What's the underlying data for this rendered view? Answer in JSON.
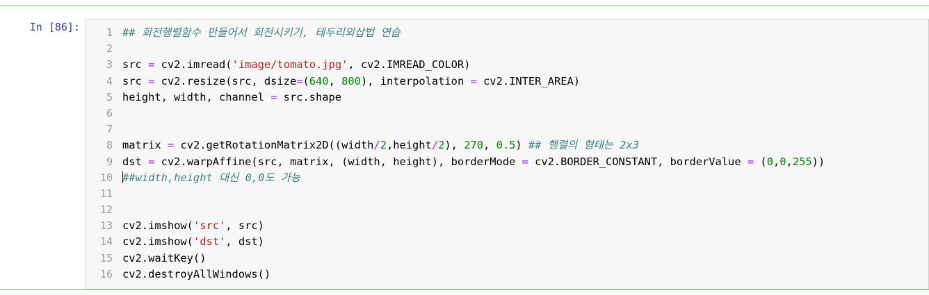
{
  "prompt": "In [86]:",
  "line_numbers": [
    "1",
    "2",
    "3",
    "4",
    "5",
    "6",
    "7",
    "8",
    "9",
    "10",
    "11",
    "12",
    "13",
    "14",
    "15",
    "16"
  ],
  "code": {
    "l1": {
      "comment": "## 회전행렬함수 만들어서 회전시키기, 테두리외삽법 연습"
    },
    "l3": {
      "a": "src ",
      "b": "=",
      "c": " cv2.imread(",
      "d": "'image/tomato.jpg'",
      "e": ", cv2.IMREAD_COLOR)"
    },
    "l4": {
      "a": "src ",
      "b": "=",
      "c": " cv2.resize(src, dsize",
      "d": "=",
      "e": "(",
      "f": "640",
      "g": ", ",
      "h": "800",
      "i": "), interpolation ",
      "j": "=",
      "k": " cv2.INTER_AREA)"
    },
    "l5": {
      "a": "height, width, channel ",
      "b": "=",
      "c": " src.shape"
    },
    "l8": {
      "a": "matrix ",
      "b": "=",
      "c": " cv2.getRotationMatrix2D((width",
      "d": "/",
      "e": "2",
      "f": ",height",
      "g": "/",
      "h": "2",
      "i": "), ",
      "j": "270",
      "k": ", ",
      "l": "0.5",
      "m": ") ",
      "n": "## 행렬의 형태는 2x3"
    },
    "l9": {
      "a": "dst ",
      "b": "=",
      "c": " cv2.warpAffine(src, matrix, (width, height), borderMode ",
      "d": "=",
      "e": " cv2.BORDER_CONSTANT, borderValue ",
      "f": "=",
      "g": " (",
      "h": "0",
      "i": ",",
      "j": "0",
      "k": ",",
      "l": "255",
      "m": "))"
    },
    "l10": {
      "comment": "##width,height 대신 0,0도 가능"
    },
    "l13": {
      "a": "cv2.imshow(",
      "b": "'src'",
      "c": ", src)"
    },
    "l14": {
      "a": "cv2.imshow(",
      "b": "'dst'",
      "c": ", dst)"
    },
    "l15": {
      "a": "cv2.waitKey()"
    },
    "l16": {
      "a": "cv2.destroyAllWindows()"
    }
  },
  "colors": {
    "prompt": "#303f9f",
    "comment": "#408080",
    "operator": "#aa22ff",
    "string": "#ba2121",
    "number": "#008000",
    "cell_border": "#66bb6a"
  }
}
